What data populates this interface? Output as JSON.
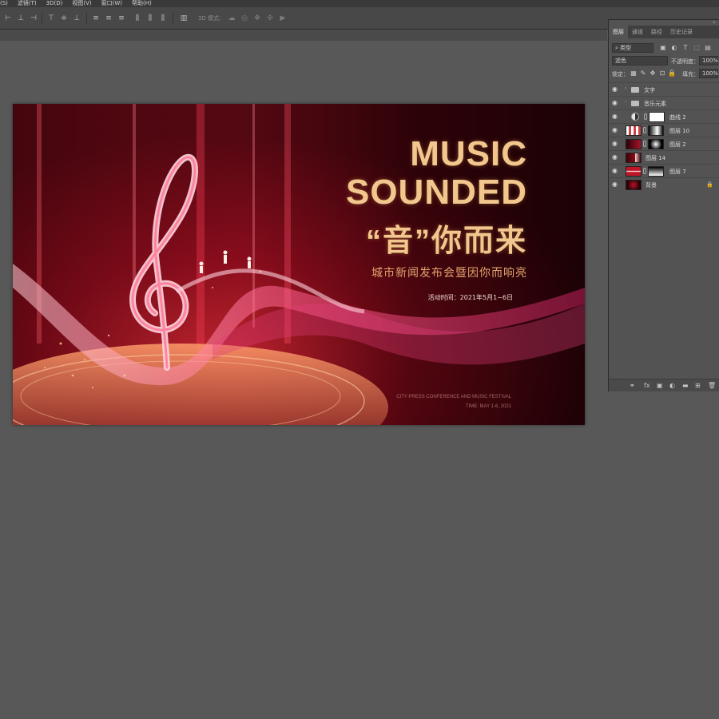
{
  "menu": {
    "items": [
      "(S)",
      "滤镜(T)",
      "3D(D)",
      "视图(V)",
      "窗口(W)",
      "帮助(H)"
    ]
  },
  "options_bar": {
    "label_3d": "3D 模式：",
    "icons": [
      "align-left-icon",
      "align-hcenter-icon",
      "align-right-icon",
      "align-top-icon",
      "align-vcenter-icon",
      "align-bottom-icon",
      "distribute-left-icon",
      "distribute-hcenter-icon",
      "distribute-right-icon",
      "distribute-top-icon",
      "distribute-vcenter-icon",
      "distribute-bottom-icon",
      "more-options-icon"
    ]
  },
  "canvas": {
    "title_line1": "MUSIC",
    "title_line2": "SOUNDED",
    "title_line3": "“音”你而来",
    "subtitle": "城市新闻发布会暨因你而响亮",
    "date_line": "活动时间：2021年5月1~6日",
    "en_line1": "CITY PRESS CONFERENCE AND MUSIC FESTIVAL",
    "en_line2": "TIME: MAY 1-6, 2021"
  },
  "layers_panel": {
    "tabs": [
      "图层",
      "通道",
      "路径",
      "历史记录"
    ],
    "active_tab": "图层",
    "filter_label": "类型",
    "blend_mode": "滤色",
    "opacity_label": "不透明度：",
    "opacity_value": "100%",
    "lock_label": "锁定：",
    "fill_label": "填充：",
    "fill_value": "100%",
    "layers": [
      {
        "name": "文字",
        "kind": "group"
      },
      {
        "name": "音乐元素",
        "kind": "group"
      },
      {
        "name": "曲线 2",
        "kind": "adjustment"
      },
      {
        "name": "图层 10",
        "kind": "masked"
      },
      {
        "name": "图层 2",
        "kind": "masked"
      },
      {
        "name": "图层 14",
        "kind": "plain"
      },
      {
        "name": "图层 7",
        "kind": "masked"
      },
      {
        "name": "背景",
        "kind": "background"
      }
    ],
    "footer_icons": [
      "link-icon",
      "fx-icon",
      "mask-icon",
      "adjustment-icon",
      "folder-icon",
      "new-layer-icon",
      "trash-icon"
    ]
  },
  "colors": {
    "title_gold": "#f2c78e",
    "subtitle_orange": "#e3a46d",
    "poster_red": "#8a0a18",
    "ui_dark": "#484848",
    "ui_panel": "#535353"
  }
}
